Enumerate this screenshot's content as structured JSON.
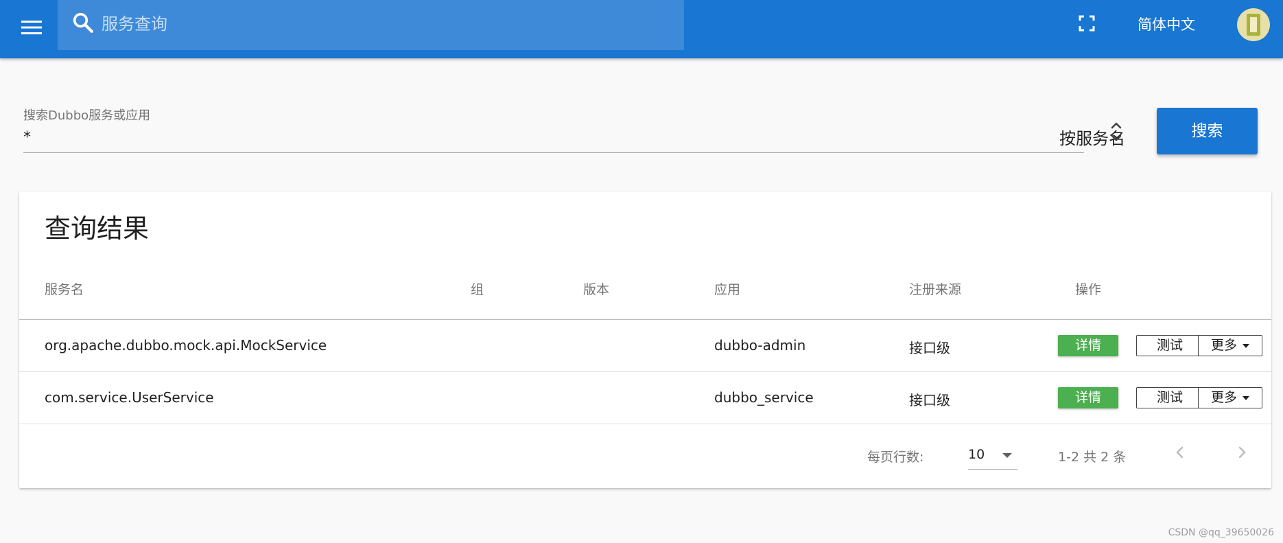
{
  "header": {
    "search_placeholder": "服务查询",
    "language": "简体中文"
  },
  "search_form": {
    "label": "搜索Dubbo服务或应用",
    "value": "*",
    "search_type": "按服务名",
    "search_button": "搜索"
  },
  "results": {
    "title": "查询结果",
    "columns": [
      "服务名",
      "组",
      "版本",
      "应用",
      "注册来源",
      "操作"
    ],
    "rows": [
      {
        "service": "org.apache.dubbo.mock.api.MockService",
        "group": "",
        "version": "",
        "application": "dubbo-admin",
        "registry_source": "接口级",
        "actions": {
          "detail": "详情",
          "test": "测试",
          "more": "更多"
        }
      },
      {
        "service": "com.service.UserService",
        "group": "",
        "version": "",
        "application": "dubbo_service",
        "registry_source": "接口级",
        "actions": {
          "detail": "详情",
          "test": "测试",
          "more": "更多"
        }
      }
    ],
    "pagination": {
      "rows_per_page_label": "每页行数:",
      "rows_per_page": "10",
      "page_info": "1-2 共 2 条"
    }
  },
  "watermark": "CSDN @qq_39650026",
  "colors": {
    "primary": "#1976d2",
    "search_bar": "#3f8ad8",
    "success": "#4caf50",
    "background": "#f9f9f9"
  },
  "icons": {
    "menu": "menu-icon",
    "search": "search-icon",
    "fullscreen": "fullscreen-icon",
    "unfold": "unfold-more-icon",
    "prev": "chevron-left-icon",
    "next": "chevron-right-icon",
    "dropdown": "arrow-drop-down-icon"
  }
}
